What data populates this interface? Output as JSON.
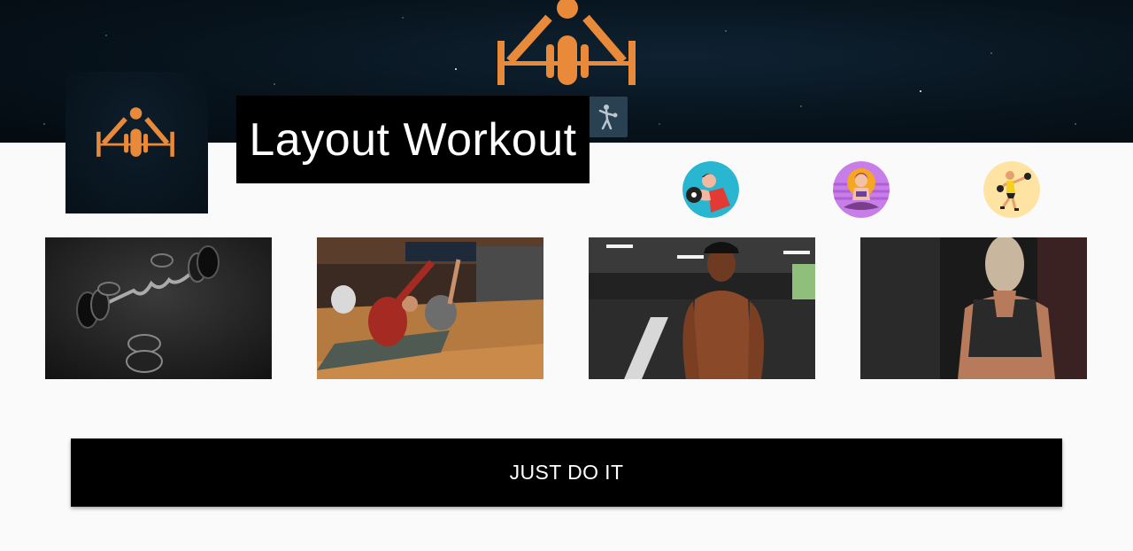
{
  "header": {
    "title": "Layout Workout"
  },
  "icons": {
    "brand_logo": "weightlifter-logo-icon",
    "stick_figure": "stick-figure-icon",
    "categories": [
      {
        "icon": "dumbbell-curl-icon",
        "bg": "#29b6d1"
      },
      {
        "icon": "yoga-meditation-icon",
        "bg": "#c77ee8"
      },
      {
        "icon": "boxing-icon",
        "bg": "#ffe3a3"
      }
    ]
  },
  "gallery": {
    "items": [
      {
        "subject": "barbell and weight plates on floor"
      },
      {
        "subject": "group stretching class"
      },
      {
        "subject": "muscular man in gym"
      },
      {
        "subject": "woman back muscles"
      }
    ]
  },
  "cta": {
    "label": "JUST DO IT"
  },
  "colors": {
    "brand_orange": "#e88a3a",
    "banner_dark": "#07131c",
    "title_bg": "#000000",
    "cta_bg": "#000000",
    "page_bg": "#fafafa"
  }
}
